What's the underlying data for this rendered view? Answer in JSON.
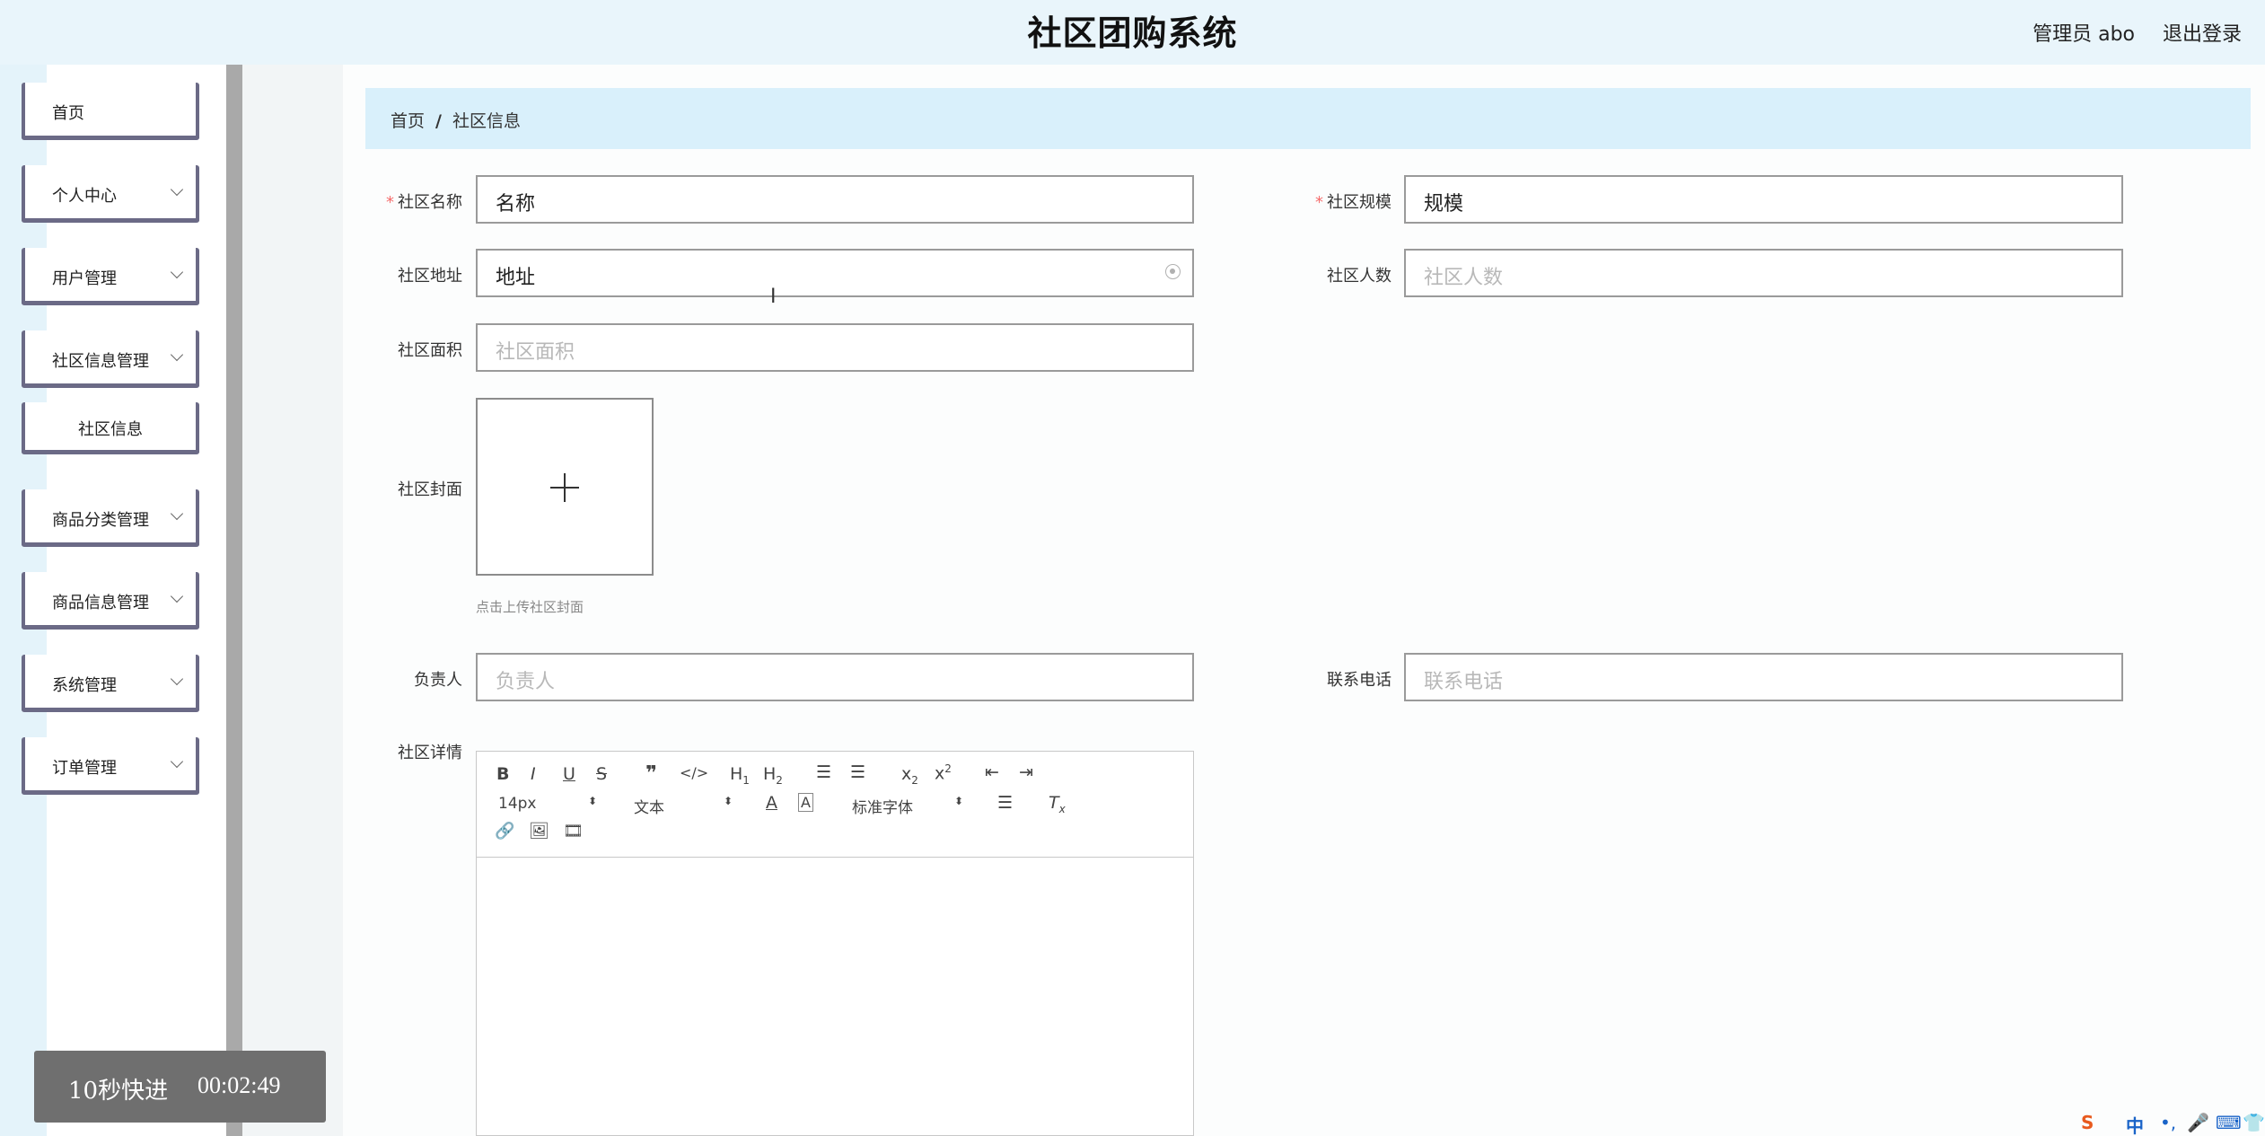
{
  "header": {
    "title": "社区团购系统",
    "user": "管理员 abo",
    "logout": "退出登录"
  },
  "sidebar": {
    "items": [
      {
        "label": "首页"
      },
      {
        "label": "个人中心"
      },
      {
        "label": "用户管理"
      },
      {
        "label": "社区信息管理"
      },
      {
        "label": "社区信息"
      },
      {
        "label": "商品分类管理"
      },
      {
        "label": "商品信息管理"
      },
      {
        "label": "系统管理"
      },
      {
        "label": "订单管理"
      }
    ]
  },
  "breadcrumb": {
    "home": "首页",
    "sep": "/",
    "current": "社区信息"
  },
  "form": {
    "name": {
      "label": "社区名称",
      "value": "名称"
    },
    "scale": {
      "label": "社区规模",
      "value": "规模"
    },
    "address": {
      "label": "社区地址",
      "value": "地址"
    },
    "population": {
      "label": "社区人数",
      "placeholder": "社区人数"
    },
    "area": {
      "label": "社区面积",
      "placeholder": "社区面积"
    },
    "cover": {
      "label": "社区封面",
      "hint": "点击上传社区封面"
    },
    "manager": {
      "label": "负责人",
      "placeholder": "负责人"
    },
    "phone": {
      "label": "联系电话",
      "placeholder": "联系电话"
    },
    "detail": {
      "label": "社区详情"
    }
  },
  "editor": {
    "size": "14px",
    "header": "文本",
    "font": "标准字体"
  },
  "overlay": {
    "ff": "10秒快进",
    "time": "00:02:49"
  },
  "ime": {
    "lang": "中"
  }
}
